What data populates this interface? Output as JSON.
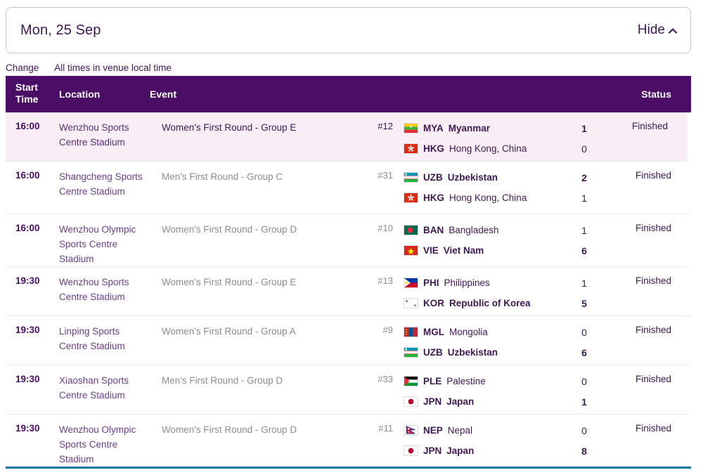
{
  "header": {
    "date_label": "Mon, 25 Sep",
    "hide_label": "Hide",
    "chevron_icon": "chevron-up-icon"
  },
  "sub_links": {
    "change_label": "Change",
    "timezone_note": "All times in venue local time"
  },
  "columns": {
    "start_time": "Start Time",
    "start_time_line1": "Start",
    "start_time_line2": "Time",
    "location": "Location",
    "event": "Event",
    "status": "Status"
  },
  "colors": {
    "header_purple": "#4a0d66",
    "text_purple": "#3f1753",
    "hover_row": "#faeff7",
    "muted_grey": "#8d8b90",
    "bottom_rule": "#1a79aa"
  },
  "rows": [
    {
      "time": "16:00",
      "location": "Wenzhou Sports Centre Stadium",
      "event": "Women's First Round - Group E",
      "match_no": "#12",
      "status": "Finished",
      "hovered": true,
      "teams": [
        {
          "code": "MYA",
          "name": "Myanmar",
          "score": "1",
          "winner": true,
          "flag": "myanmar-flag-icon"
        },
        {
          "code": "HKG",
          "name": "Hong Kong, China",
          "score": "0",
          "winner": false,
          "flag": "hong-kong-flag-icon"
        }
      ]
    },
    {
      "time": "16:00",
      "location": "Shangcheng Sports Centre Stadium",
      "event": "Men's First Round - Group C",
      "match_no": "#31",
      "status": "Finished",
      "hovered": false,
      "teams": [
        {
          "code": "UZB",
          "name": "Uzbekistan",
          "score": "2",
          "winner": true,
          "flag": "uzbekistan-flag-icon"
        },
        {
          "code": "HKG",
          "name": "Hong Kong, China",
          "score": "1",
          "winner": false,
          "flag": "hong-kong-flag-icon"
        }
      ]
    },
    {
      "time": "16:00",
      "location": "Wenzhou Olympic Sports Centre Stadium",
      "event": "Women's First Round - Group D",
      "match_no": "#10",
      "status": "Finished",
      "hovered": false,
      "teams": [
        {
          "code": "BAN",
          "name": "Bangladesh",
          "score": "1",
          "winner": false,
          "flag": "bangladesh-flag-icon"
        },
        {
          "code": "VIE",
          "name": "Viet Nam",
          "score": "6",
          "winner": true,
          "flag": "vietnam-flag-icon"
        }
      ]
    },
    {
      "time": "19:30",
      "location": "Wenzhou Sports Centre Stadium",
      "event": "Women's First Round - Group E",
      "match_no": "#13",
      "status": "Finished",
      "hovered": false,
      "teams": [
        {
          "code": "PHI",
          "name": "Philippines",
          "score": "1",
          "winner": false,
          "flag": "philippines-flag-icon"
        },
        {
          "code": "KOR",
          "name": "Republic of Korea",
          "score": "5",
          "winner": true,
          "flag": "korea-flag-icon"
        }
      ]
    },
    {
      "time": "19:30",
      "location": "Linping Sports Centre Stadium",
      "event": "Women's First Round - Group A",
      "match_no": "#9",
      "status": "Finished",
      "hovered": false,
      "teams": [
        {
          "code": "MGL",
          "name": "Mongolia",
          "score": "0",
          "winner": false,
          "flag": "mongolia-flag-icon"
        },
        {
          "code": "UZB",
          "name": "Uzbekistan",
          "score": "6",
          "winner": true,
          "flag": "uzbekistan-flag-icon"
        }
      ]
    },
    {
      "time": "19:30",
      "location": "Xiaoshan Sports Centre Stadium",
      "event": "Men's First Round - Group D",
      "match_no": "#33",
      "status": "Finished",
      "hovered": false,
      "teams": [
        {
          "code": "PLE",
          "name": "Palestine",
          "score": "0",
          "winner": false,
          "flag": "palestine-flag-icon"
        },
        {
          "code": "JPN",
          "name": "Japan",
          "score": "1",
          "winner": true,
          "flag": "japan-flag-icon"
        }
      ]
    },
    {
      "time": "19:30",
      "location": "Wenzhou Olympic Sports Centre Stadium",
      "event": "Women's First Round - Group D",
      "match_no": "#11",
      "status": "Finished",
      "hovered": false,
      "teams": [
        {
          "code": "NEP",
          "name": "Nepal",
          "score": "0",
          "winner": false,
          "flag": "nepal-flag-icon"
        },
        {
          "code": "JPN",
          "name": "Japan",
          "score": "8",
          "winner": true,
          "flag": "japan-flag-icon"
        }
      ]
    }
  ]
}
